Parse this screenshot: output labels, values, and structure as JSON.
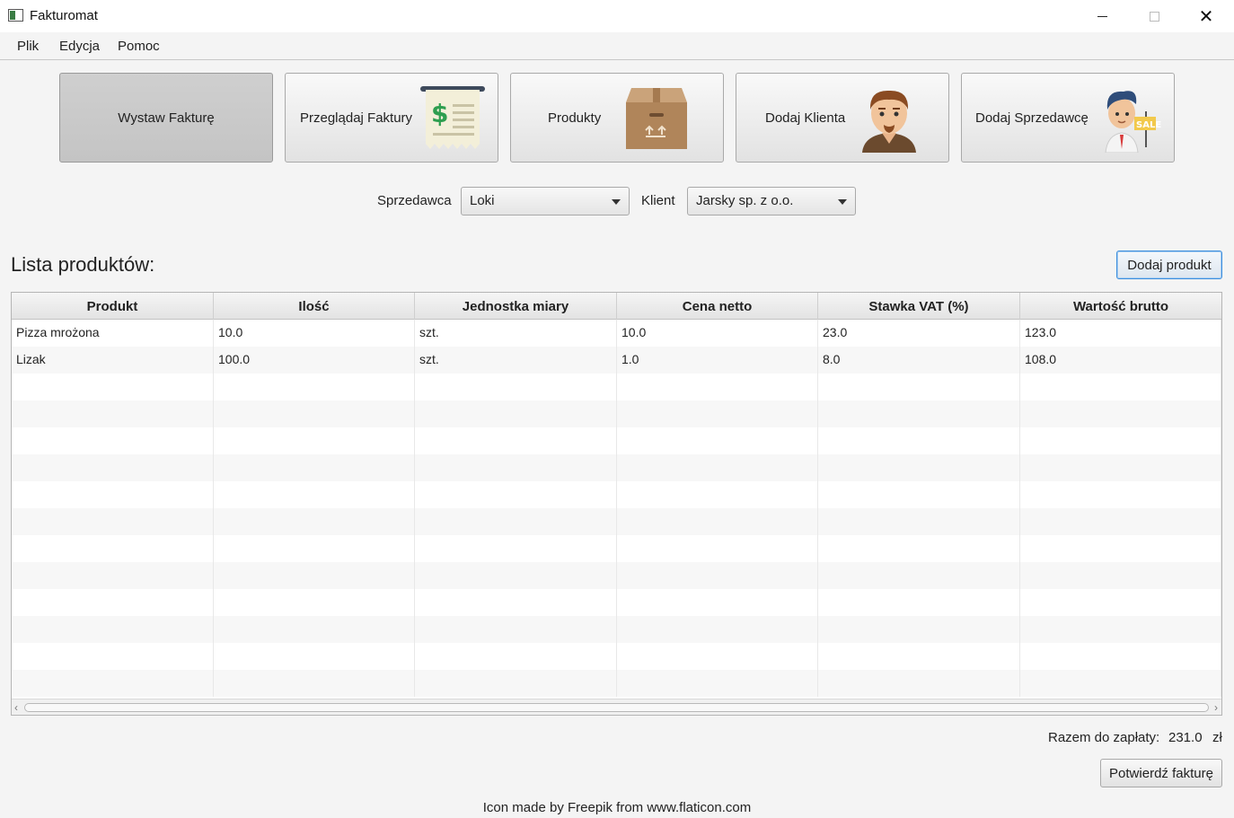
{
  "window": {
    "title": "Fakturomat",
    "close_glyph": "✕"
  },
  "menu": {
    "items": [
      "Plik",
      "Edycja",
      "Pomoc"
    ]
  },
  "actions": {
    "issue_invoice": "Wystaw Fakturę",
    "browse_invoices": "Przeglądaj Faktury",
    "products": "Produkty",
    "add_client": "Dodaj Klienta",
    "add_seller": "Dodaj Sprzedawcę",
    "sale_tag": "SALE"
  },
  "selectors": {
    "seller_label": "Sprzedawca",
    "seller_value": "Loki",
    "client_label": "Klient",
    "client_value": "Jarsky sp. z o.o."
  },
  "list": {
    "title": "Lista produktów:",
    "add_button": "Dodaj produkt"
  },
  "table": {
    "columns": [
      "Produkt",
      "Ilość",
      "Jednostka miary",
      "Cena netto",
      "Stawka VAT (%)",
      "Wartość brutto"
    ],
    "rows": [
      [
        "Pizza mrożona",
        "10.0",
        "szt.",
        "10.0",
        "23.0",
        "123.0"
      ],
      [
        "Lizak",
        "100.0",
        "szt.",
        "1.0",
        "8.0",
        "108.0"
      ]
    ]
  },
  "summary": {
    "total_label": "Razem do zapłaty:",
    "total_value": "231.0",
    "currency": "zł",
    "confirm_button": "Potwierdź fakturę"
  },
  "footer": {
    "credit": "Icon made by Freepik from www.flaticon.com"
  },
  "colors": {
    "accent_border": "#3c8ede",
    "active_button": "#c9c9c9"
  }
}
